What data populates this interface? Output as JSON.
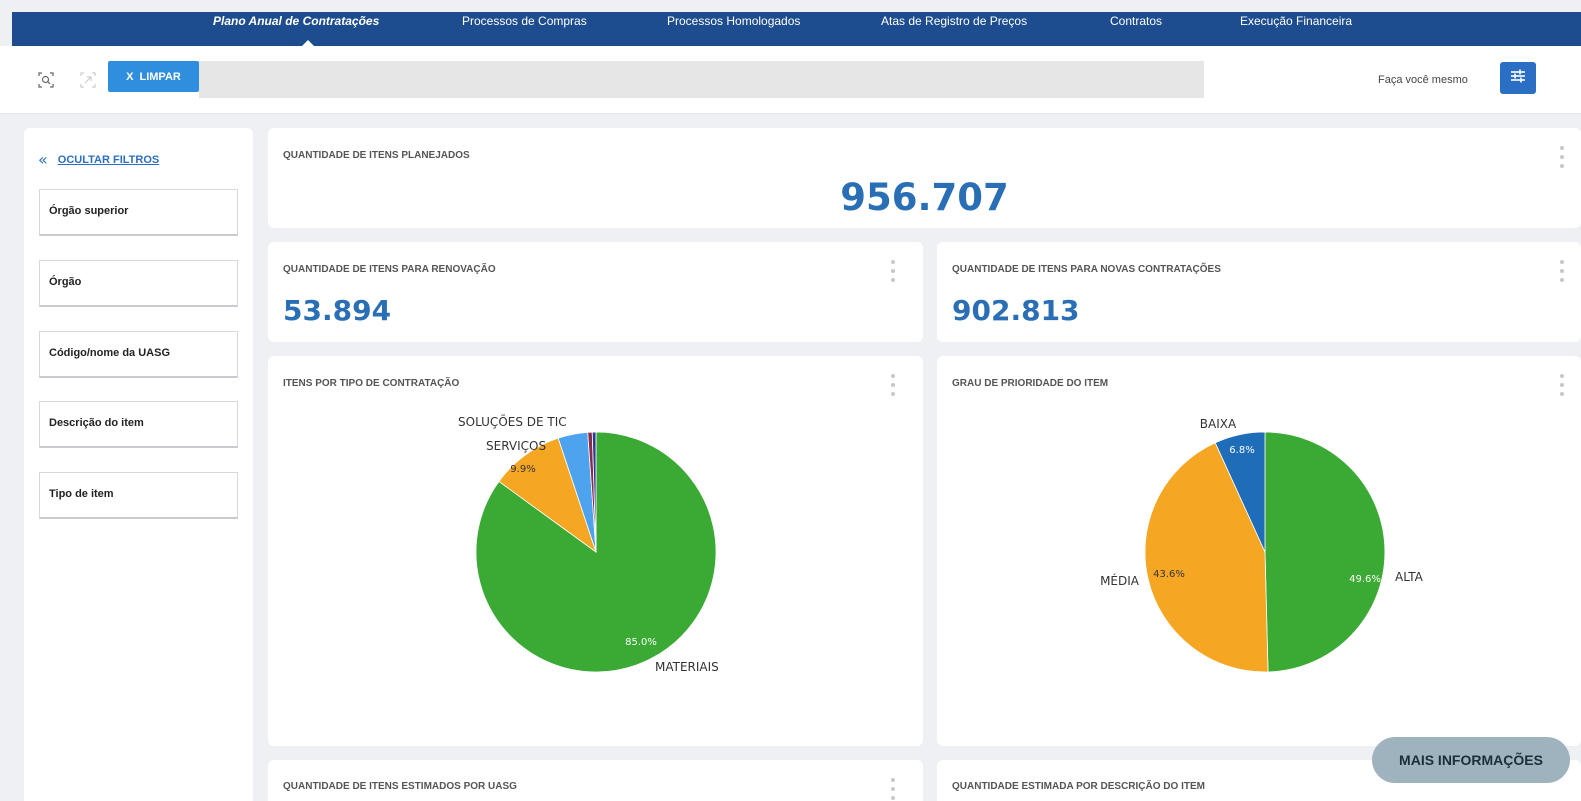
{
  "nav": {
    "items": [
      {
        "label": "Plano Anual de Contratações",
        "active": true
      },
      {
        "label": "Processos de Compras",
        "active": false
      },
      {
        "label": "Processos Homologados",
        "active": false
      },
      {
        "label": "Atas de Registro de Preços",
        "active": false
      },
      {
        "label": "Contratos",
        "active": false
      },
      {
        "label": "Execução Financeira",
        "active": false
      }
    ]
  },
  "toolbar": {
    "clear_label": "LIMPAR",
    "clear_icon_text": "X",
    "diy_label": "Faça você mesmo",
    "icons": [
      "smart-search-icon",
      "selections-tool-icon",
      "filter-settings-icon"
    ]
  },
  "sidebar": {
    "hide_filters_label": "OCULTAR FILTROS",
    "filters": [
      "Órgão superior",
      "Órgão",
      "Código/nome da UASG",
      "Descrição do item",
      "Tipo de item"
    ]
  },
  "kpi_total": {
    "title": "QUANTIDADE DE ITENS PLANEJADOS",
    "value": "956.707"
  },
  "kpi_renewal": {
    "title": "QUANTIDADE DE ITENS PARA RENOVAÇÃO",
    "value": "53.894"
  },
  "kpi_new": {
    "title": "QUANTIDADE DE ITENS PARA NOVAS CONTRATAÇÕES",
    "value": "902.813"
  },
  "chart_type_title": "ITENS POR TIPO DE CONTRATAÇÃO",
  "chart_priority_title": "GRAU DE PRIORIDADE DO ITEM",
  "bottom_left_title": "QUANTIDADE DE ITENS ESTIMADOS POR UASG",
  "bottom_right_title": "QUANTIDADE ESTIMADA POR DESCRIÇÃO DO ITEM",
  "more_info_label": "MAIS INFORMAÇÕES",
  "chart_data": [
    {
      "type": "pie",
      "title": "ITENS POR TIPO DE CONTRATAÇÃO",
      "slices": [
        {
          "label": "MATERIAIS",
          "value": 85.0,
          "value_label": "85.0%",
          "color": "#3aaa35"
        },
        {
          "label": "SERVIÇOS",
          "value": 9.9,
          "value_label": "9.9%",
          "color": "#f5a623"
        },
        {
          "label": "SOLUÇÕES DE TIC",
          "value": 4.0,
          "value_label": "",
          "color": "#4da3ee"
        },
        {
          "label": "",
          "value": 0.6,
          "value_label": "",
          "color": "#8a2b4a"
        },
        {
          "label": "",
          "value": 0.5,
          "value_label": "",
          "color": "#2b3b8f"
        }
      ]
    },
    {
      "type": "pie",
      "title": "GRAU DE PRIORIDADE DO ITEM",
      "slices": [
        {
          "label": "ALTA",
          "value": 49.6,
          "value_label": "49.6%",
          "color": "#3aaa35"
        },
        {
          "label": "MÉDIA",
          "value": 43.6,
          "value_label": "43.6%",
          "color": "#f5a623"
        },
        {
          "label": "BAIXA",
          "value": 6.8,
          "value_label": "6.8%",
          "color": "#1f6cb8"
        }
      ]
    }
  ]
}
